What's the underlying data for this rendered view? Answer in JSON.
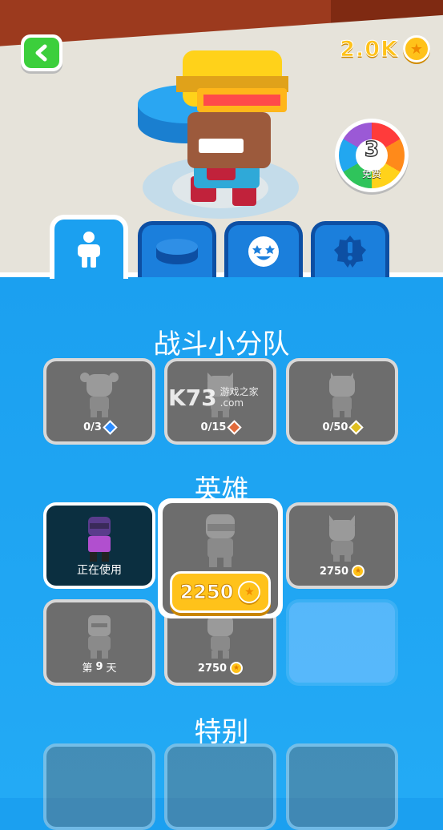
{
  "header": {
    "coins": "2.0K",
    "spin_count": "3",
    "spin_label": "免费"
  },
  "tabs": [
    {
      "name": "character-tab",
      "icon": "person-icon",
      "active": true
    },
    {
      "name": "disc-tab",
      "icon": "disc-icon",
      "active": false
    },
    {
      "name": "emote-tab",
      "icon": "star-eyes-icon",
      "active": false
    },
    {
      "name": "badge-tab",
      "icon": "badge-icon",
      "active": false
    }
  ],
  "sections": {
    "squad": {
      "title": "战斗小分队",
      "items": [
        {
          "progress": "0/3",
          "gem_color": "#2a8cff"
        },
        {
          "progress": "0/15",
          "gem_color": "#e26a3a"
        },
        {
          "progress": "0/50",
          "gem_color": "#e0c020"
        }
      ]
    },
    "heroes": {
      "title": "英雄",
      "in_use_label": "正在使用",
      "featured_price": "2250",
      "items": [
        {
          "label": "2750"
        },
        {
          "label_prefix": "第",
          "label_number": "9",
          "label_suffix": "天"
        },
        {
          "label": "2750"
        }
      ]
    },
    "special": {
      "title": "特别"
    }
  },
  "watermark": {
    "logo": "K73",
    "text": "游戏之家",
    "domain": ".com"
  }
}
